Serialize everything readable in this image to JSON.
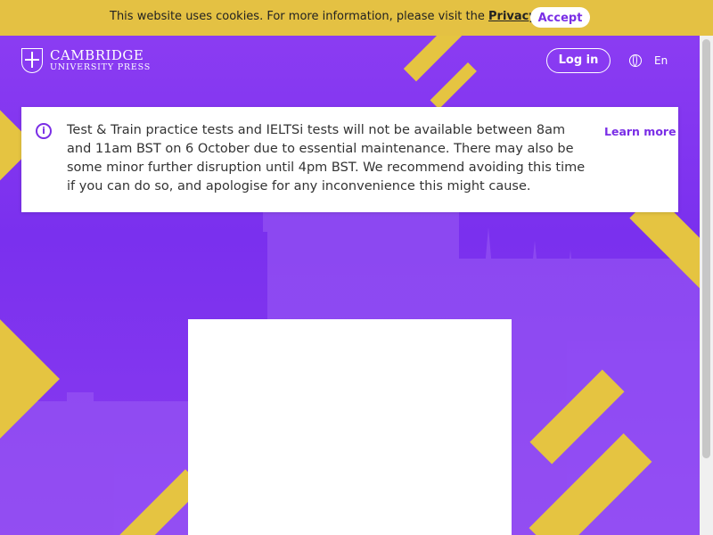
{
  "cookie": {
    "text": "This website uses cookies. For more information, please visit the",
    "link": "Privacy notice.",
    "accept": "Accept"
  },
  "header": {
    "logo_line1": "CAMBRIDGE",
    "logo_line2": "UNIVERSITY PRESS",
    "login": "Log in",
    "language": "En"
  },
  "notice": {
    "message": "Test & Train practice tests and IELTSi tests will not be available between 8am and 11am BST on 6 October due to essential maintenance. There may also be some minor further disruption until 4pm BST. We recommend avoiding this time if you can do so, and apologise for any inconvenience this might cause.",
    "learn_more": "Learn more"
  },
  "colors": {
    "accent": "#7a2ee6",
    "yellow": "#e4c143",
    "background": "#8a3cf0"
  },
  "icons": {
    "info": "info-icon",
    "globe": "globe-icon",
    "shield": "cambridge-shield-icon"
  }
}
